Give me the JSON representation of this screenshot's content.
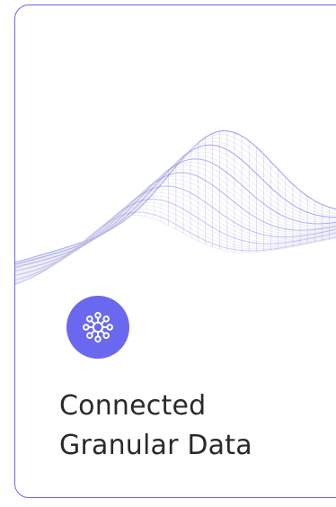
{
  "card": {
    "title_line1": "Connected",
    "title_line2": "Granular Data",
    "icon": "network-hub-icon"
  },
  "colors": {
    "accent": "#6b68f0",
    "title_text": "#2a2a2e",
    "mesh_light": "#d9d9e6",
    "mesh_accent": "#7d7af2"
  }
}
